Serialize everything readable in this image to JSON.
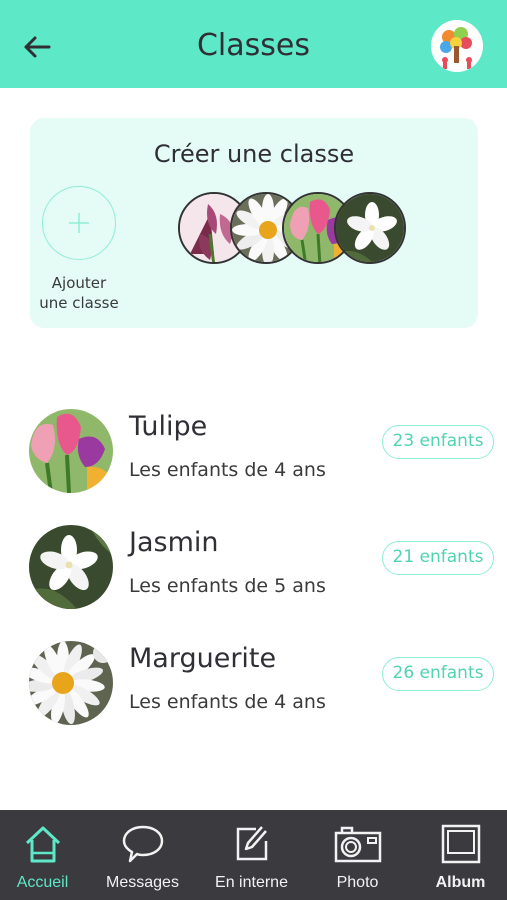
{
  "header": {
    "title": "Classes",
    "back_icon": "arrow-left-icon",
    "avatar_icon": "school-logo-icon"
  },
  "create_card": {
    "title": "Créer une classe",
    "add_label_line1": "Ajouter",
    "add_label_line2": "une classe",
    "thumbnails": [
      "orchid",
      "daisy",
      "tulip",
      "jasmine"
    ]
  },
  "classes": [
    {
      "name": "Tulipe",
      "description": "Les enfants de 4 ans",
      "count": "23 enfants",
      "image": "tulip"
    },
    {
      "name": "Jasmin",
      "description": "Les enfants de 5 ans",
      "count": "21 enfants",
      "image": "jasmine"
    },
    {
      "name": "Marguerite",
      "description": "Les enfants de 4 ans",
      "count": "26 enfants",
      "image": "daisy"
    }
  ],
  "nav": {
    "items": [
      {
        "label": "Accueil",
        "icon": "home-icon",
        "active": true
      },
      {
        "label": "Messages",
        "icon": "chat-bubble-icon",
        "active": false
      },
      {
        "label": "En interne",
        "icon": "edit-icon",
        "active": false
      },
      {
        "label": "Photo",
        "icon": "camera-icon",
        "active": false
      },
      {
        "label": "Album",
        "icon": "album-icon",
        "active": false
      }
    ]
  },
  "colors": {
    "accent": "#5de8c8",
    "card_bg": "#e5fbf5",
    "nav_bg": "#3a3a3f",
    "badge_text": "#4fd3b2"
  }
}
